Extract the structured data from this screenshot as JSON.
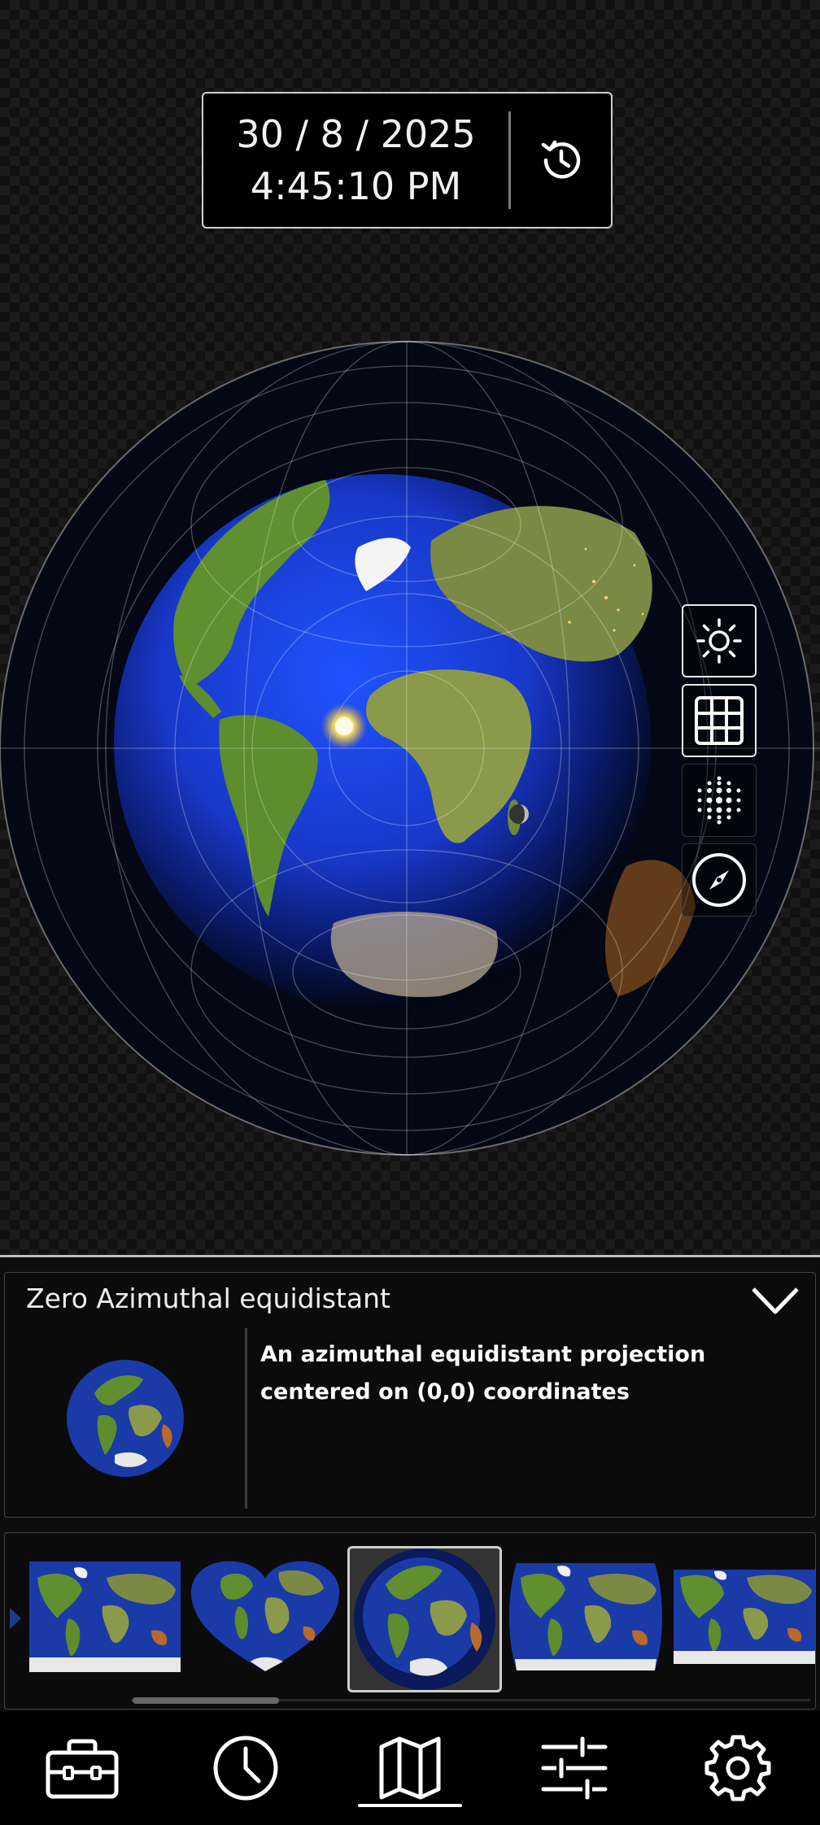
{
  "datetime": {
    "date": "30 / 8 / 2025",
    "time": "4:45:10 PM",
    "history_icon": "history-icon"
  },
  "map_layers": [
    {
      "name": "sun-layer",
      "icon": "sun-icon",
      "active": true
    },
    {
      "name": "grid-layer",
      "icon": "grid-icon",
      "active": true
    },
    {
      "name": "dots-layer",
      "icon": "dots-icon",
      "active": false
    },
    {
      "name": "compass-layer",
      "icon": "compass-icon",
      "active": false
    }
  ],
  "projection": {
    "title": "Zero Azimuthal equidistant",
    "description": "An azimuthal equidistant projection centered on (0,0) coordinates",
    "expand_icon": "chevron-down-icon"
  },
  "thumbnails": [
    {
      "name": "equirectangular",
      "selected": false
    },
    {
      "name": "heart-shaped",
      "selected": false
    },
    {
      "name": "zero-azimuthal-equidistant",
      "selected": true
    },
    {
      "name": "robinson",
      "selected": false
    },
    {
      "name": "mercator",
      "selected": false
    }
  ],
  "nav": [
    {
      "name": "toolbox",
      "icon": "toolbox-icon",
      "active": false
    },
    {
      "name": "clock",
      "icon": "clock-icon",
      "active": false
    },
    {
      "name": "map",
      "icon": "map-icon",
      "active": true
    },
    {
      "name": "adjustments",
      "icon": "sliders-icon",
      "active": false
    },
    {
      "name": "settings",
      "icon": "gear-icon",
      "active": false
    }
  ],
  "colors": {
    "ocean": "#1a3fc4",
    "land": "#5a8a2e",
    "ice": "#f0f0f0",
    "night": "#02050f"
  }
}
